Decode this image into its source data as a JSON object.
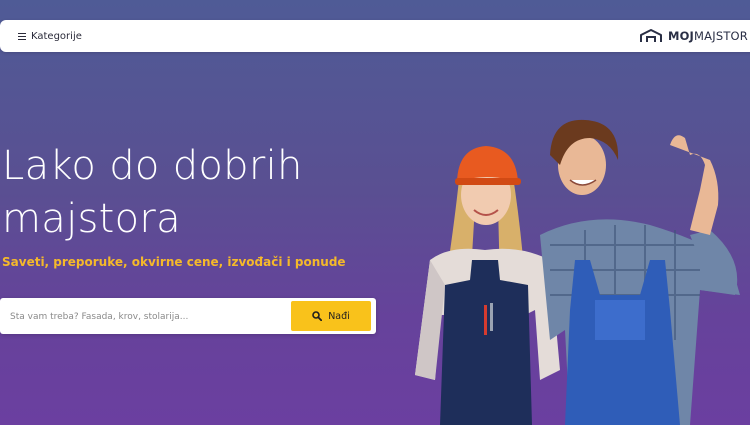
{
  "header": {
    "menu_label": "Kategorije",
    "menu_icon": "hamburger-icon",
    "logo_bold": "MOJ",
    "logo_light": "MAJSTOR",
    "logo_icon": "house-roof-icon"
  },
  "hero": {
    "title_line1": "Lako do dobrih",
    "title_line2": "majstora",
    "subtitle": "Saveti, preporuke, okvirne cene, izvođači i ponude"
  },
  "search": {
    "placeholder": "Šta vam treba? Fasada, krov, stolarija...",
    "button_label": "Nađi",
    "button_icon": "search-icon"
  },
  "colors": {
    "accent": "#f9c21b",
    "subtitle": "#f5b92a",
    "bg_top": "#4f5b96",
    "bg_bottom": "#6b3fa0"
  }
}
